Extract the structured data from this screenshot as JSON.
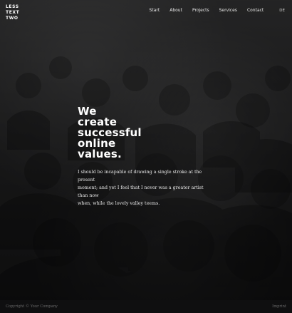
{
  "header": {
    "logo_lines": [
      "LESS",
      "TEXT",
      "TWO"
    ],
    "nav": [
      {
        "label": "Start"
      },
      {
        "label": "About"
      },
      {
        "label": "Projects"
      },
      {
        "label": "Services"
      },
      {
        "label": "Contact"
      }
    ],
    "language": "DE"
  },
  "hero": {
    "title_lines": [
      "We",
      "create",
      "successful",
      "online",
      "values."
    ],
    "description_lines": [
      "I should be incapable of drawing a single stroke at the present",
      "moment; and yet I feel that I never was a greater artist than now",
      "when, while the lovely valley teems."
    ]
  },
  "footer": {
    "copyright": "Copyright © Your Company",
    "imprint": "Imprint"
  },
  "colors": {
    "background": "#0f0f10",
    "text_primary": "#ffffff"
  }
}
